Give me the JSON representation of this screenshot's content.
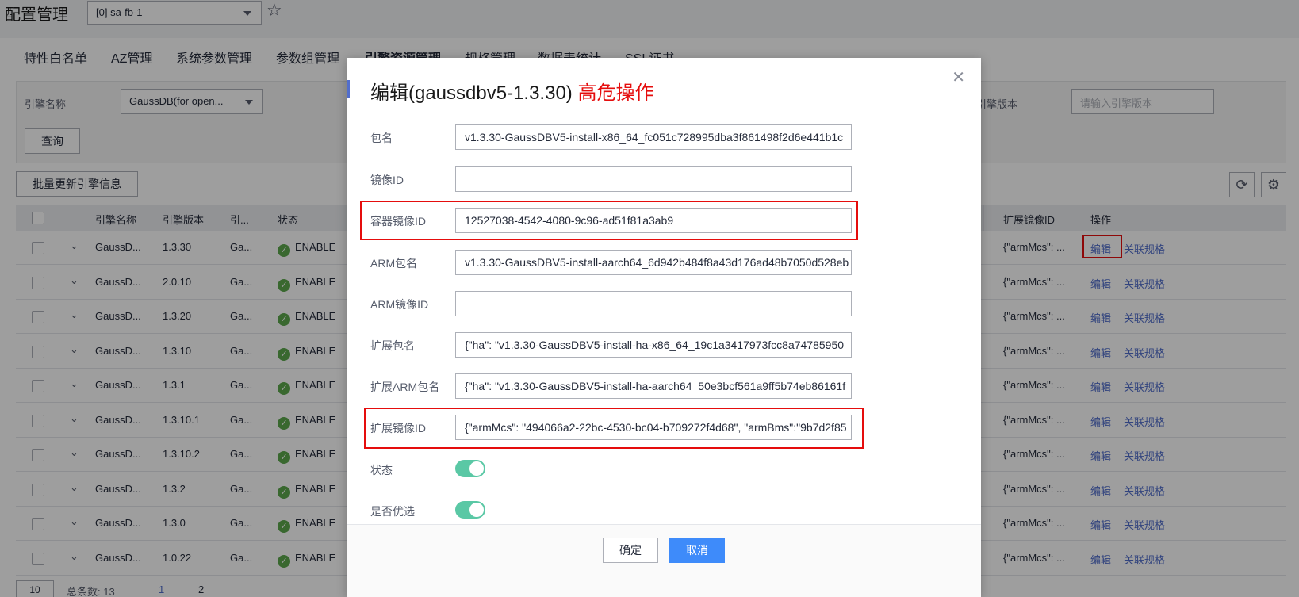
{
  "header": {
    "title": "配置管理",
    "region": "[0] sa-fb-1"
  },
  "tabs": [
    "特性白名单",
    "AZ管理",
    "系统参数管理",
    "参数组管理",
    "引擎资源管理",
    "规格管理",
    "数据表统计",
    "SSL证书"
  ],
  "filters": {
    "engine_name_label": "引擎名称",
    "engine_name_value": "GaussDB(for open...",
    "engine_version_label": "引擎版本",
    "engine_version_placeholder": "请输入引擎版本",
    "query_button": "查询"
  },
  "toolbar": {
    "batch_update_button": "批量更新引擎信息"
  },
  "table": {
    "columns": [
      "引擎名称",
      "引擎版本",
      "引...",
      "状态",
      "扩展镜像ID",
      "操作"
    ],
    "rows": [
      {
        "name": "GaussD...",
        "version": "1.3.30",
        "type": "Ga...",
        "status": "ENABLE",
        "ext_image": "{\"armMcs\": ...",
        "edit": "编辑",
        "assoc": "关联规格"
      },
      {
        "name": "GaussD...",
        "version": "2.0.10",
        "type": "Ga...",
        "status": "ENABLE",
        "ext_image": "{\"armMcs\": ...",
        "edit": "编辑",
        "assoc": "关联规格"
      },
      {
        "name": "GaussD...",
        "version": "1.3.20",
        "type": "Ga...",
        "status": "ENABLE",
        "ext_image": "{\"armMcs\": ...",
        "edit": "编辑",
        "assoc": "关联规格"
      },
      {
        "name": "GaussD...",
        "version": "1.3.10",
        "type": "Ga...",
        "status": "ENABLE",
        "ext_image": "{\"armMcs\": ...",
        "edit": "编辑",
        "assoc": "关联规格"
      },
      {
        "name": "GaussD...",
        "version": "1.3.1",
        "type": "Ga...",
        "status": "ENABLE",
        "ext_image": "{\"armMcs\": ...",
        "edit": "编辑",
        "assoc": "关联规格"
      },
      {
        "name": "GaussD...",
        "version": "1.3.10.1",
        "type": "Ga...",
        "status": "ENABLE",
        "ext_image": "{\"armMcs\": ...",
        "edit": "编辑",
        "assoc": "关联规格"
      },
      {
        "name": "GaussD...",
        "version": "1.3.10.2",
        "type": "Ga...",
        "status": "ENABLE",
        "ext_image": "{\"armMcs\": ...",
        "edit": "编辑",
        "assoc": "关联规格"
      },
      {
        "name": "GaussD...",
        "version": "1.3.2",
        "type": "Ga...",
        "status": "ENABLE",
        "ext_image": "{\"armMcs\": ...",
        "edit": "编辑",
        "assoc": "关联规格"
      },
      {
        "name": "GaussD...",
        "version": "1.3.0",
        "type": "Ga...",
        "status": "ENABLE",
        "ext_image": "{\"armMcs\": ...",
        "edit": "编辑",
        "assoc": "关联规格"
      },
      {
        "name": "GaussD...",
        "version": "1.0.22",
        "type": "Ga...",
        "status": "ENABLE",
        "ext_image": "{\"armMcs\": ...",
        "edit": "编辑",
        "assoc": "关联规格"
      }
    ]
  },
  "pager": {
    "page_size": "10",
    "total": "总条数: 13",
    "pages": [
      "1",
      "2"
    ]
  },
  "modal": {
    "title": "编辑(gaussdbv5-1.3.30)",
    "warning": "高危操作",
    "fields": [
      {
        "label": "包名",
        "value": "v1.3.30-GaussDBV5-install-x86_64_fc051c728995dba3f861498f2d6e441b1c"
      },
      {
        "label": "镜像ID",
        "value": ""
      },
      {
        "label": "容器镜像ID",
        "value": "12527038-4542-4080-9c96-ad51f81a3ab9"
      },
      {
        "label": "ARM包名",
        "value": "v1.3.30-GaussDBV5-install-aarch64_6d942b484f8a43d176ad48b7050d528eb"
      },
      {
        "label": "ARM镜像ID",
        "value": ""
      },
      {
        "label": "扩展包名",
        "value": "{\"ha\": \"v1.3.30-GaussDBV5-install-ha-x86_64_19c1a3417973fcc8a74785950"
      },
      {
        "label": "扩展ARM包名",
        "value": "{\"ha\": \"v1.3.30-GaussDBV5-install-ha-aarch64_50e3bcf561a9ff5b74eb86161f"
      },
      {
        "label": "扩展镜像ID",
        "value": "{\"armMcs\": \"494066a2-22bc-4530-bc04-b709272f4d68\", \"armBms\":\"9b7d2f85"
      }
    ],
    "status_label": "状态",
    "status_on": true,
    "preferred_label": "是否优选",
    "preferred_on": true,
    "ok_button": "确定",
    "cancel_button": "取消"
  },
  "colors": {
    "danger": "#e50d0d",
    "link": "#526ecc",
    "toggle_on": "#5ac8a5",
    "primary": "#3e8bfa"
  }
}
